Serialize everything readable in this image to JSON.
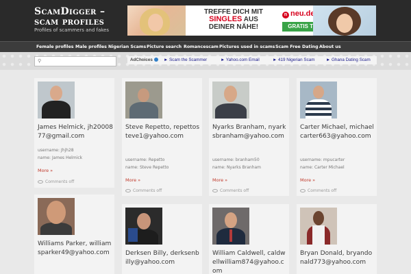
{
  "site": {
    "title_line1": "ScamDigger –",
    "title_line2": "scam profiles",
    "subtitle": "Profiles of scammers and fakes"
  },
  "ad_banner": {
    "headline_1": "TREFFE DICH MIT",
    "headline_2": "SINGLES",
    "headline_3": "AUS",
    "headline_4": "DEINER NÄHE!",
    "brand": "neu.de",
    "cta": "GRATIS TESTEN"
  },
  "nav": {
    "items": [
      {
        "label": "Female profiles"
      },
      {
        "label": "Male profiles"
      },
      {
        "label": "Nigerian Scams"
      },
      {
        "label": "Picture search"
      },
      {
        "label": "Romancescam"
      },
      {
        "label": "Pictures used in scams"
      },
      {
        "label": "Scam Free Dating"
      },
      {
        "label": "About us"
      }
    ]
  },
  "search": {
    "placeholder": ""
  },
  "ad_links": {
    "adchoices": "AdChoices",
    "links": [
      {
        "label": "► Scam the Scammer"
      },
      {
        "label": "► Yahoo.com Email"
      },
      {
        "label": "► 419 Nigerian Scam"
      },
      {
        "label": "► Ghana Dating Scam"
      }
    ]
  },
  "cards": [
    {
      "name": "James Helmick, jh2000877@gmail.com",
      "username": "username: Jhjh28",
      "realname": "name: James Helmick",
      "more": "More »",
      "comments": "Comments off"
    },
    {
      "name": "Steve Repetto, repettosteve1@yahoo.com",
      "username": "username: Repetto",
      "realname": "name: Steve Repetto",
      "more": "More »",
      "comments": "Comments off"
    },
    {
      "name": "Nyarks Branham, nyarksbranham@yahoo.com",
      "username": "username: branham50",
      "realname": "name: Nyarks Branham",
      "more": "More »",
      "comments": "Comments off"
    },
    {
      "name": "Carter Michael, michaelcarter663@yahoo.com",
      "username": "username: mpucarter",
      "realname": "name: Carter Michael",
      "more": "More »",
      "comments": "Comments off"
    },
    {
      "name": "Williams Parker, williamsparker49@yahoo.com"
    },
    {
      "name": "Derksen Billy, derksenbilly@yahoo.com"
    },
    {
      "name": "William Caldwell, caldwellwilliam874@yahoo.com"
    },
    {
      "name": "Bryan Donald, bryandonald773@yahoo.com"
    }
  ]
}
